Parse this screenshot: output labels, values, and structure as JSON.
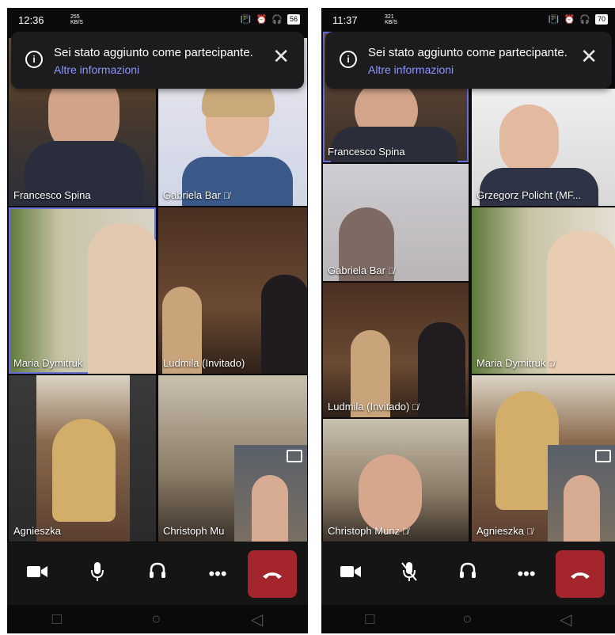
{
  "left_phone": {
    "status": {
      "time": "12:36",
      "net": "255\nKB/S",
      "battery": "56"
    },
    "banner": {
      "message": "Sei stato aggiunto come partecipante.",
      "link": "Altre informazioni"
    },
    "tiles": [
      {
        "name": "Francesco Spina"
      },
      {
        "name": "Gabriela Bar"
      },
      {
        "name": "Maria Dymitruk"
      },
      {
        "name": "Ludmila (Invitado)"
      },
      {
        "name": "Agnieszka"
      },
      {
        "name": "Christoph Mu"
      }
    ],
    "controls": {
      "video": "video-camera-icon",
      "mic": "mic-icon",
      "audio": "headset-icon",
      "more": "more-icon",
      "hangup": "hangup-icon"
    }
  },
  "right_phone": {
    "status": {
      "time": "11:37",
      "net": "321\nKB/S",
      "battery": "70"
    },
    "banner": {
      "message": "Sei stato aggiunto come partecipante.",
      "link": "Altre informazioni"
    },
    "tiles": [
      {
        "name": "Francesco Spina"
      },
      {
        "name": "Grzegorz Policht (MF..."
      },
      {
        "name": "Gabriela Bar"
      },
      {
        "name": "Maria Dymitruk"
      },
      {
        "name": "Ludmila (Invitado)"
      },
      {
        "name": "Agnieszka"
      },
      {
        "name": "Christoph Munz"
      }
    ],
    "controls": {
      "video": "video-camera-icon",
      "mic": "mic-muted-icon",
      "audio": "headset-icon",
      "more": "more-icon",
      "hangup": "hangup-icon"
    }
  },
  "colors": {
    "accent": "#6a6fd8",
    "hangup": "#a4262c",
    "link": "#8d95ff"
  }
}
